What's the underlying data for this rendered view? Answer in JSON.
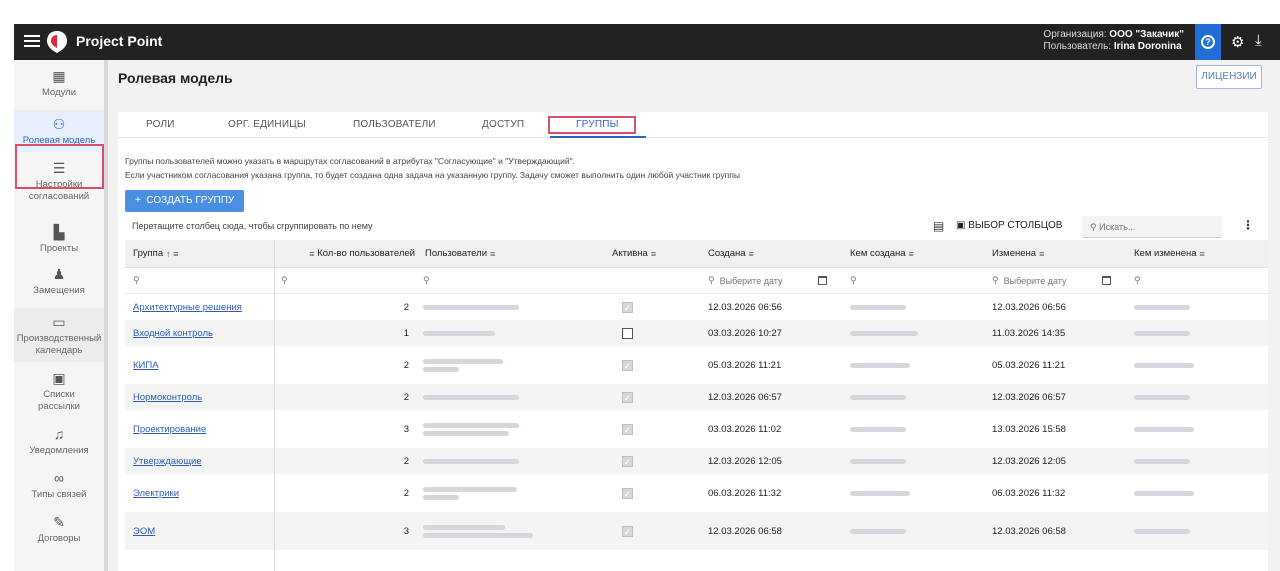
{
  "app": {
    "brand": "Project Point"
  },
  "header": {
    "org_label": "Организация:",
    "org_value": "ООО \"Закачик\"",
    "user_label": "Пользователь:",
    "user_value": "Irina Doronina"
  },
  "sidebar": {
    "items": [
      {
        "label": "Модули"
      },
      {
        "label": "Ролевая модель"
      },
      {
        "label1": "Настройки",
        "label2": "согласований"
      },
      {
        "label": "Проекты"
      },
      {
        "label": "Замещения"
      },
      {
        "label1": "Производственный",
        "label2": "календарь"
      },
      {
        "label1": "Списки",
        "label2": "рассылки"
      },
      {
        "label": "Уведомления"
      },
      {
        "label": "Типы связей"
      },
      {
        "label": "Договоры"
      }
    ]
  },
  "page": {
    "title": "Ролевая модель",
    "license_btn": "ЛИЦЕНЗИИ",
    "tabs": [
      "РОЛИ",
      "ОРГ. ЕДИНИЦЫ",
      "ПОЛЬЗОВАТЕЛИ",
      "ДОСТУП",
      "ГРУППЫ"
    ],
    "info_line1": "Группы пользователей можно указать в маршрутах согласований в атрибутах \"Согласующие\" и \"Утверждающий\".",
    "info_line2": "Если участником согласования указана группа, то будет создана одна задача на указанную группу. Задачу сможет выполнить один любой участник группы",
    "create_btn": "СОЗДАТЬ ГРУППУ",
    "drag_hint": "Перетащите столбец сюда, чтобы сгруппировать по нему",
    "columns_btn": "ВЫБОР СТОЛБЦОВ",
    "search_placeholder": "Искать...",
    "date_placeholder": "Выберите дату"
  },
  "table": {
    "headers": {
      "group": "Группа",
      "count": "Кол-во пользователей",
      "users": "Пользователи",
      "active": "Активна",
      "created": "Создана",
      "created_by": "Кем создана",
      "modified": "Изменена",
      "modified_by": "Кем изменена"
    },
    "rows": [
      {
        "group": "Архитектурные решения",
        "count": "2",
        "active": true,
        "created": "12.03.2026 06:56",
        "modified": "12.03.2026 06:56"
      },
      {
        "group": "Входной контроль",
        "count": "1",
        "active": false,
        "created": "03.03.2026 10:27",
        "modified": "11.03.2026 14:35"
      },
      {
        "group": "КИПА",
        "count": "2",
        "active": true,
        "created": "05.03.2026 11:21",
        "modified": "05.03.2026 11:21"
      },
      {
        "group": "Нормоконтроль",
        "count": "2",
        "active": true,
        "created": "12.03.2026 06:57",
        "modified": "12.03.2026 06:57"
      },
      {
        "group": "Проектирование",
        "count": "3",
        "active": true,
        "created": "03.03.2026 11:02",
        "modified": "13.03.2026 15:58"
      },
      {
        "group": "Утверждающие",
        "count": "2",
        "active": true,
        "created": "12.03.2026 12:05",
        "modified": "12.03.2026 12:05"
      },
      {
        "group": "Электрики",
        "count": "2",
        "active": true,
        "created": "06.03.2026 11:32",
        "modified": "06.03.2026 11:32"
      },
      {
        "group": "ЭОМ",
        "count": "3",
        "active": true,
        "created": "12.03.2026 06:58",
        "modified": "12.03.2026 06:58"
      }
    ]
  },
  "colors": {
    "topbar": "#222222",
    "accent": "#2f63c5",
    "button": "#4a90e2",
    "highlight": "#d8506a"
  }
}
